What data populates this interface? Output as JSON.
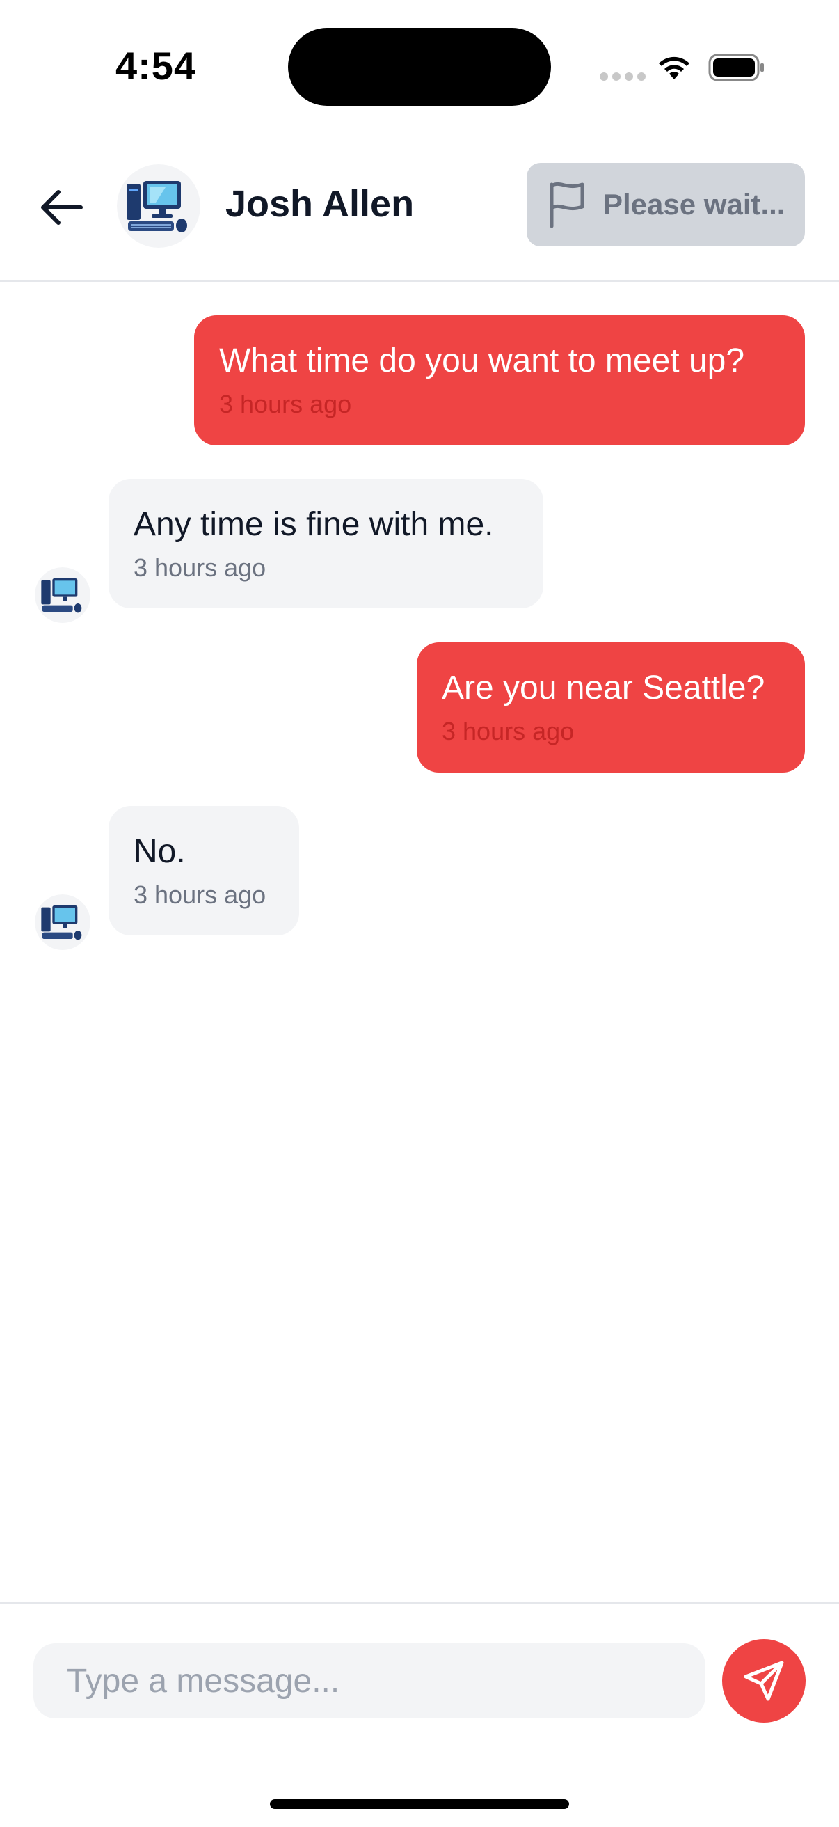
{
  "status_bar": {
    "time": "4:54",
    "icons": [
      "cellular-signal-icon",
      "wifi-icon",
      "battery-icon"
    ]
  },
  "header": {
    "contact_name": "Josh Allen",
    "avatar_icon": "desktop-computer-icon",
    "back_icon": "arrow-left-icon",
    "report_button": {
      "label": "Please wait...",
      "icon": "flag-icon",
      "disabled": true
    }
  },
  "messages": [
    {
      "direction": "outgoing",
      "text": "What time do you want to meet up?",
      "time": "3 hours ago"
    },
    {
      "direction": "incoming",
      "text": "Any time is fine with me.",
      "time": "3 hours ago"
    },
    {
      "direction": "outgoing",
      "text": "Are you near Seattle?",
      "time": "3 hours ago"
    },
    {
      "direction": "incoming",
      "text": "No.",
      "time": "3 hours ago"
    }
  ],
  "composer": {
    "placeholder": "Type a message...",
    "value": "",
    "send_icon": "paper-plane-icon"
  },
  "colors": {
    "accent": "#ef4444",
    "incoming_bubble": "#f3f4f6",
    "disabled_button": "#d1d5db"
  }
}
